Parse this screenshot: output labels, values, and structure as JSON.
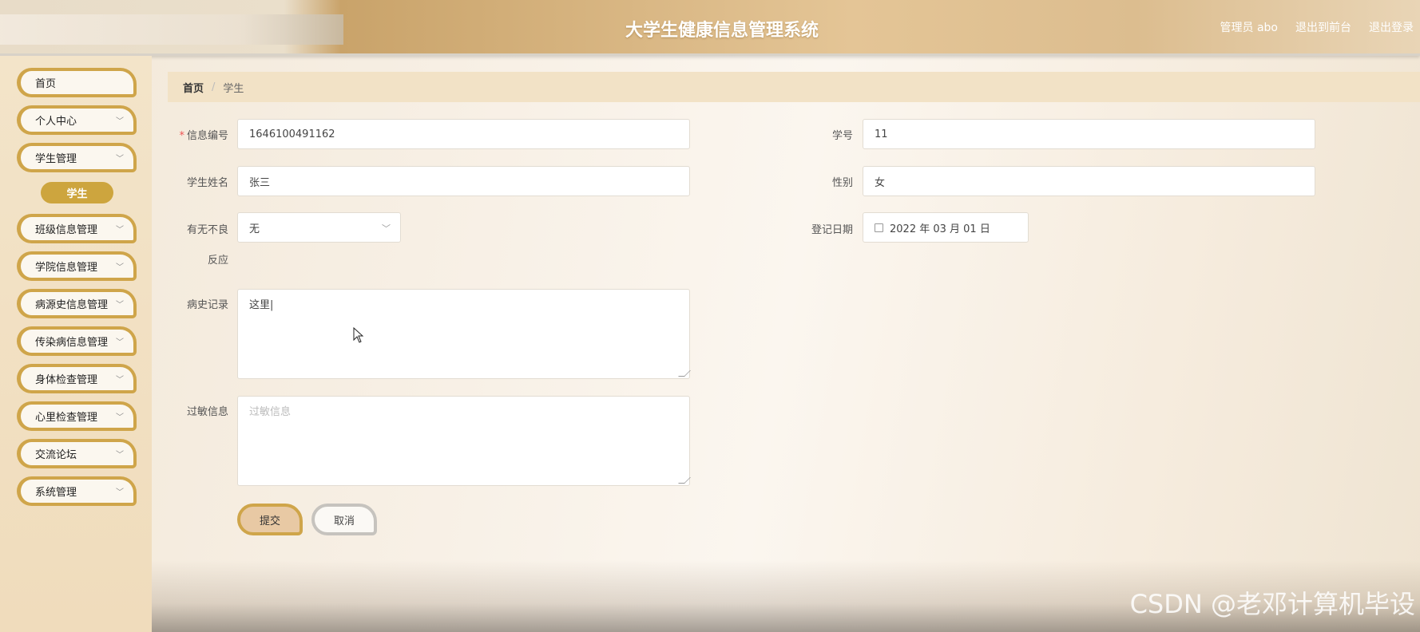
{
  "header": {
    "title": "大学生健康信息管理系统",
    "admin": "管理员 abo",
    "front_link": "退出到前台",
    "logout": "退出登录"
  },
  "sidebar": {
    "items": [
      {
        "label": "首页",
        "chevron": false
      },
      {
        "label": "个人中心",
        "chevron": true
      },
      {
        "label": "学生管理",
        "chevron": true
      },
      {
        "label": "班级信息管理",
        "chevron": true
      },
      {
        "label": "学院信息管理",
        "chevron": true
      },
      {
        "label": "病源史信息管理",
        "chevron": true
      },
      {
        "label": "传染病信息管理",
        "chevron": true
      },
      {
        "label": "身体检查管理",
        "chevron": true
      },
      {
        "label": "心里检查管理",
        "chevron": true
      },
      {
        "label": "交流论坛",
        "chevron": true
      },
      {
        "label": "系统管理",
        "chevron": true
      }
    ],
    "active_sub": "学生"
  },
  "breadcrumb": {
    "home": "首页",
    "separator": "/",
    "current": "学生"
  },
  "form": {
    "info_id": {
      "label": "信息编号",
      "required_mark": "*",
      "value": "1646100491162"
    },
    "student_no": {
      "label": "学号",
      "value": "11"
    },
    "name": {
      "label": "学生姓名",
      "value": "张三"
    },
    "gender": {
      "label": "性别",
      "value": "女"
    },
    "adverse": {
      "label_line1": "有无不良",
      "label_line2": "反应",
      "value": "无"
    },
    "reg_date": {
      "label": "登记日期",
      "value": "2022 年 03 月 01 日"
    },
    "history": {
      "label": "病史记录",
      "value": "这里|"
    },
    "allergy": {
      "label": "过敏信息",
      "placeholder": "过敏信息"
    },
    "submit": "提交",
    "cancel": "取消"
  },
  "watermark": "CSDN @老邓计算机毕设"
}
